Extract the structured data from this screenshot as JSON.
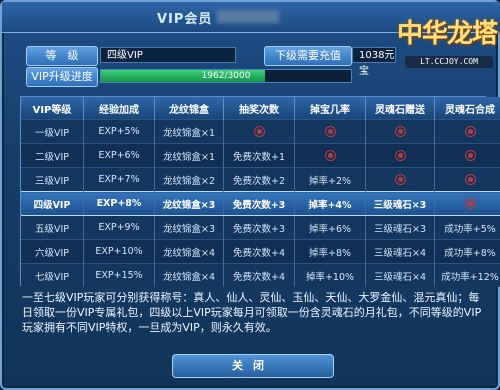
{
  "window": {
    "title": "VIP会员"
  },
  "logo": {
    "main": "中华龙塔",
    "sub": "LT.CCJOY.COM"
  },
  "header": {
    "level_label": "等　级",
    "level_value": "四级VIP",
    "next_label": "下级需要充值",
    "next_value": "1038元宝",
    "progress_label": "VIP升级进度",
    "progress_text": "1962/3000",
    "progress_fraction": 0.654
  },
  "table": {
    "columns": [
      "VIP等级",
      "经验加成",
      "龙纹锦盒",
      "抽奖次数",
      "掉宝几率",
      "灵魂石赠送",
      "灵魂石合成"
    ],
    "rows": [
      [
        "一级VIP",
        "EXP+5%",
        "龙纹锦盒×1",
        "mark",
        "mark",
        "mark",
        "mark"
      ],
      [
        "二级VIP",
        "EXP+6%",
        "龙纹锦盒×1",
        "免费次数+1",
        "mark",
        "mark",
        "mark"
      ],
      [
        "三级VIP",
        "EXP+7%",
        "龙纹锦盒×2",
        "免费次数+2",
        "掉率+2%",
        "mark",
        "mark"
      ],
      [
        "四级VIP",
        "EXP+8%",
        "龙纹锦盒×3",
        "免费次数+3",
        "掉率+4%",
        "三级魂石×3",
        "mark"
      ],
      [
        "五级VIP",
        "EXP+9%",
        "龙纹锦盒×3",
        "免费次数+3",
        "掉率+6%",
        "三级魂石×3",
        "成功率+5%"
      ],
      [
        "六级VIP",
        "EXP+10%",
        "龙纹锦盒×4",
        "免费次数+4",
        "掉率+8%",
        "三级魂石×4",
        "成功率+8%"
      ],
      [
        "七级VIP",
        "EXP+15%",
        "龙纹锦盒×4",
        "免费次数+4",
        "掉率+10%",
        "三级魂石×4",
        "成功率+12%"
      ]
    ],
    "highlight_row": 3
  },
  "description": "一至七级VIP玩家可分别获得称号：真人、仙人、灵仙、玉仙、天仙、大罗金仙、混元真仙；每日领取一份VIP专属礼包，四级以上VIP玩家每月可领取一份含灵魂石的月礼包，不同等级的VIP玩家拥有不同VIP特权，一旦成为VIP，则永久有效。",
  "footer": {
    "close_label": "关闭"
  }
}
